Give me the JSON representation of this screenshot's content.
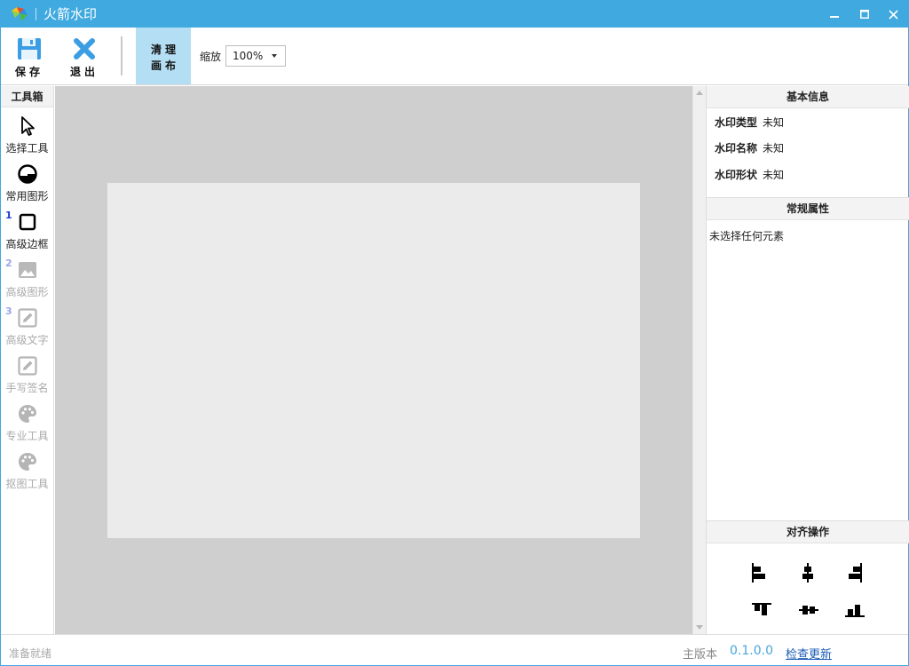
{
  "colors": {
    "accent": "#3fa9e0",
    "canvas_bg": "#cfcfcf",
    "paper": "#ebebeb",
    "active_tool_bg": "#b3def3"
  },
  "titlebar": {
    "title": "火箭水印"
  },
  "toolbar": {
    "save_label": "保存",
    "exit_label": "退出",
    "clear_line1": "清理",
    "clear_line2": "画布",
    "zoom_label": "缩放",
    "zoom_value": "100%"
  },
  "toolbox": {
    "header": "工具箱",
    "tools": [
      {
        "label": "选择工具",
        "icon": "cursor-icon",
        "number": "",
        "enabled": true
      },
      {
        "label": "常用图形",
        "icon": "shape-circle-icon",
        "number": "",
        "enabled": true
      },
      {
        "label": "高级边框",
        "icon": "square-frame-icon",
        "number": "1",
        "enabled": true
      },
      {
        "label": "高级图形",
        "icon": "image-icon",
        "number": "2",
        "enabled": false
      },
      {
        "label": "高级文字",
        "icon": "edit-icon",
        "number": "3",
        "enabled": false
      },
      {
        "label": "手写签名",
        "icon": "edit-icon",
        "number": "",
        "enabled": false
      },
      {
        "label": "专业工具",
        "icon": "palette-icon",
        "number": "",
        "enabled": false
      },
      {
        "label": "抠图工具",
        "icon": "palette-icon",
        "number": "",
        "enabled": false
      }
    ]
  },
  "right_panel": {
    "basic_info": {
      "title": "基本信息",
      "rows": [
        {
          "key": "水印类型",
          "value": "未知"
        },
        {
          "key": "水印名称",
          "value": "未知"
        },
        {
          "key": "水印形状",
          "value": "未知"
        }
      ]
    },
    "general_props": {
      "title": "常规属性",
      "empty_text": "未选择任何元素"
    },
    "align": {
      "title": "对齐操作",
      "buttons": [
        "align-left-icon",
        "align-center-horizontal-icon",
        "align-right-icon",
        "align-top-icon",
        "align-middle-vertical-icon",
        "align-bottom-icon"
      ]
    }
  },
  "statusbar": {
    "status": "准备就绪",
    "version_label": "主版本",
    "version": "0.1.0.0",
    "check_update": "检查更新"
  }
}
